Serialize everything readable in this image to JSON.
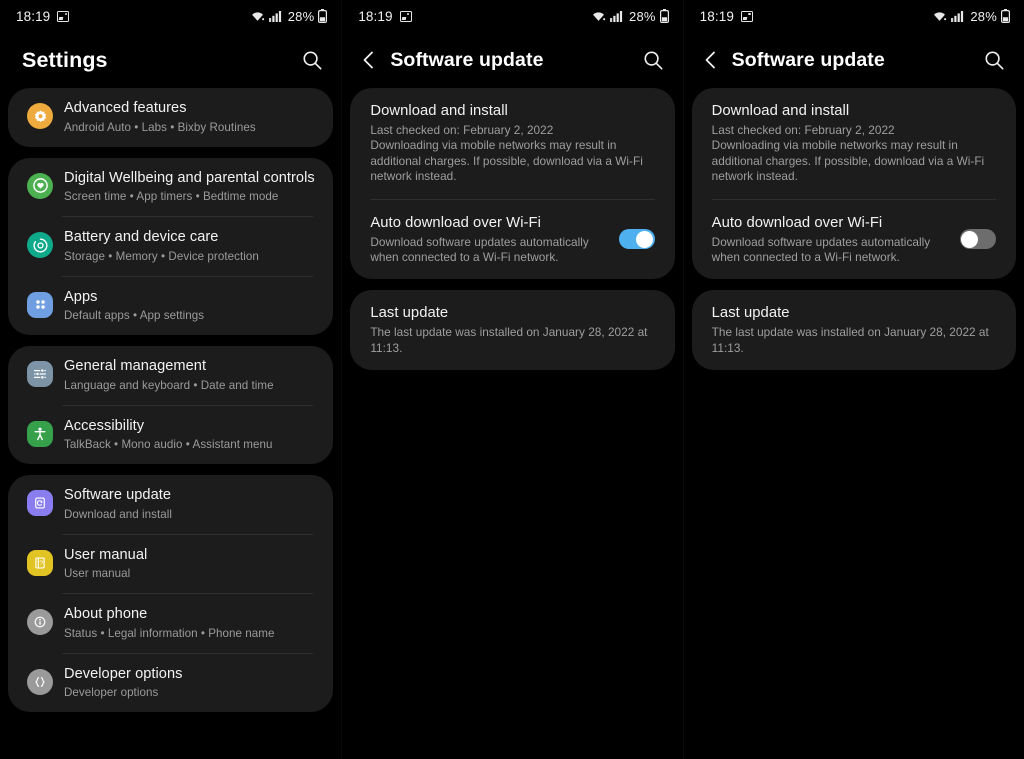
{
  "statusbar": {
    "time": "18:19",
    "battery": "28%",
    "icons": [
      "image-icon",
      "wifi-icon",
      "signal-icon",
      "battery-icon"
    ]
  },
  "screen1": {
    "header": {
      "title": "Settings",
      "search_icon": "search-icon"
    },
    "groups": [
      {
        "items": [
          {
            "title": "Advanced features",
            "subtitle": "Android Auto  •  Labs  •  Bixby Routines",
            "icon": "advanced-features-icon",
            "color": "#eeaa3c"
          }
        ]
      },
      {
        "items": [
          {
            "title": "Digital Wellbeing and parental controls",
            "subtitle": "Screen time  •  App timers  •  Bedtime mode",
            "icon": "digital-wellbeing-icon",
            "color": "#4caf50"
          },
          {
            "title": "Battery and device care",
            "subtitle": "Storage  •  Memory  •  Device protection",
            "icon": "battery-device-care-icon",
            "color": "#0fa98c"
          },
          {
            "title": "Apps",
            "subtitle": "Default apps  •  App settings",
            "icon": "apps-icon",
            "color": "#6f9fe0"
          }
        ]
      },
      {
        "items": [
          {
            "title": "General management",
            "subtitle": "Language and keyboard  •  Date and time",
            "icon": "general-management-icon",
            "color": "#7d94a6"
          },
          {
            "title": "Accessibility",
            "subtitle": "TalkBack  •  Mono audio  •  Assistant menu",
            "icon": "accessibility-icon",
            "color": "#37a04a"
          }
        ]
      },
      {
        "items": [
          {
            "title": "Software update",
            "subtitle": "Download and install",
            "icon": "software-update-icon",
            "color": "#8a7df0"
          },
          {
            "title": "User manual",
            "subtitle": "User manual",
            "icon": "user-manual-icon",
            "color": "#e2c324"
          },
          {
            "title": "About phone",
            "subtitle": "Status  •  Legal information  •  Phone name",
            "icon": "about-phone-icon",
            "color": "#9a9a9a"
          },
          {
            "title": "Developer options",
            "subtitle": "Developer options",
            "icon": "developer-options-icon",
            "color": "#9a9a9a"
          }
        ]
      }
    ]
  },
  "screen2": {
    "header": {
      "title": "Software update",
      "back_icon": "back-chevron-icon",
      "search_icon": "search-icon"
    },
    "download": {
      "title": "Download and install",
      "sub_line1": "Last checked on: February 2, 2022",
      "sub_line2": "Downloading via mobile networks may result in additional charges. If possible, download via a Wi-Fi network instead."
    },
    "auto_download": {
      "title": "Auto download over Wi-Fi",
      "subtitle": "Download software updates automatically when connected to a Wi-Fi network.",
      "toggle_state": "on",
      "toggle_color": "#4fb0f0"
    },
    "last_update": {
      "title": "Last update",
      "subtitle": "The last update was installed on January 28, 2022 at 11:13."
    }
  },
  "screen3": {
    "header": {
      "title": "Software update",
      "back_icon": "back-chevron-icon",
      "search_icon": "search-icon"
    },
    "download": {
      "title": "Download and install",
      "sub_line1": "Last checked on: February 2, 2022",
      "sub_line2": "Downloading via mobile networks may result in additional charges. If possible, download via a Wi-Fi network instead."
    },
    "auto_download": {
      "title": "Auto download over Wi-Fi",
      "subtitle": "Download software updates automatically when connected to a Wi-Fi network.",
      "toggle_state": "off",
      "toggle_color": "#6d6d6d"
    },
    "last_update": {
      "title": "Last update",
      "subtitle": "The last update was installed on January 28, 2022 at 11:13."
    }
  }
}
